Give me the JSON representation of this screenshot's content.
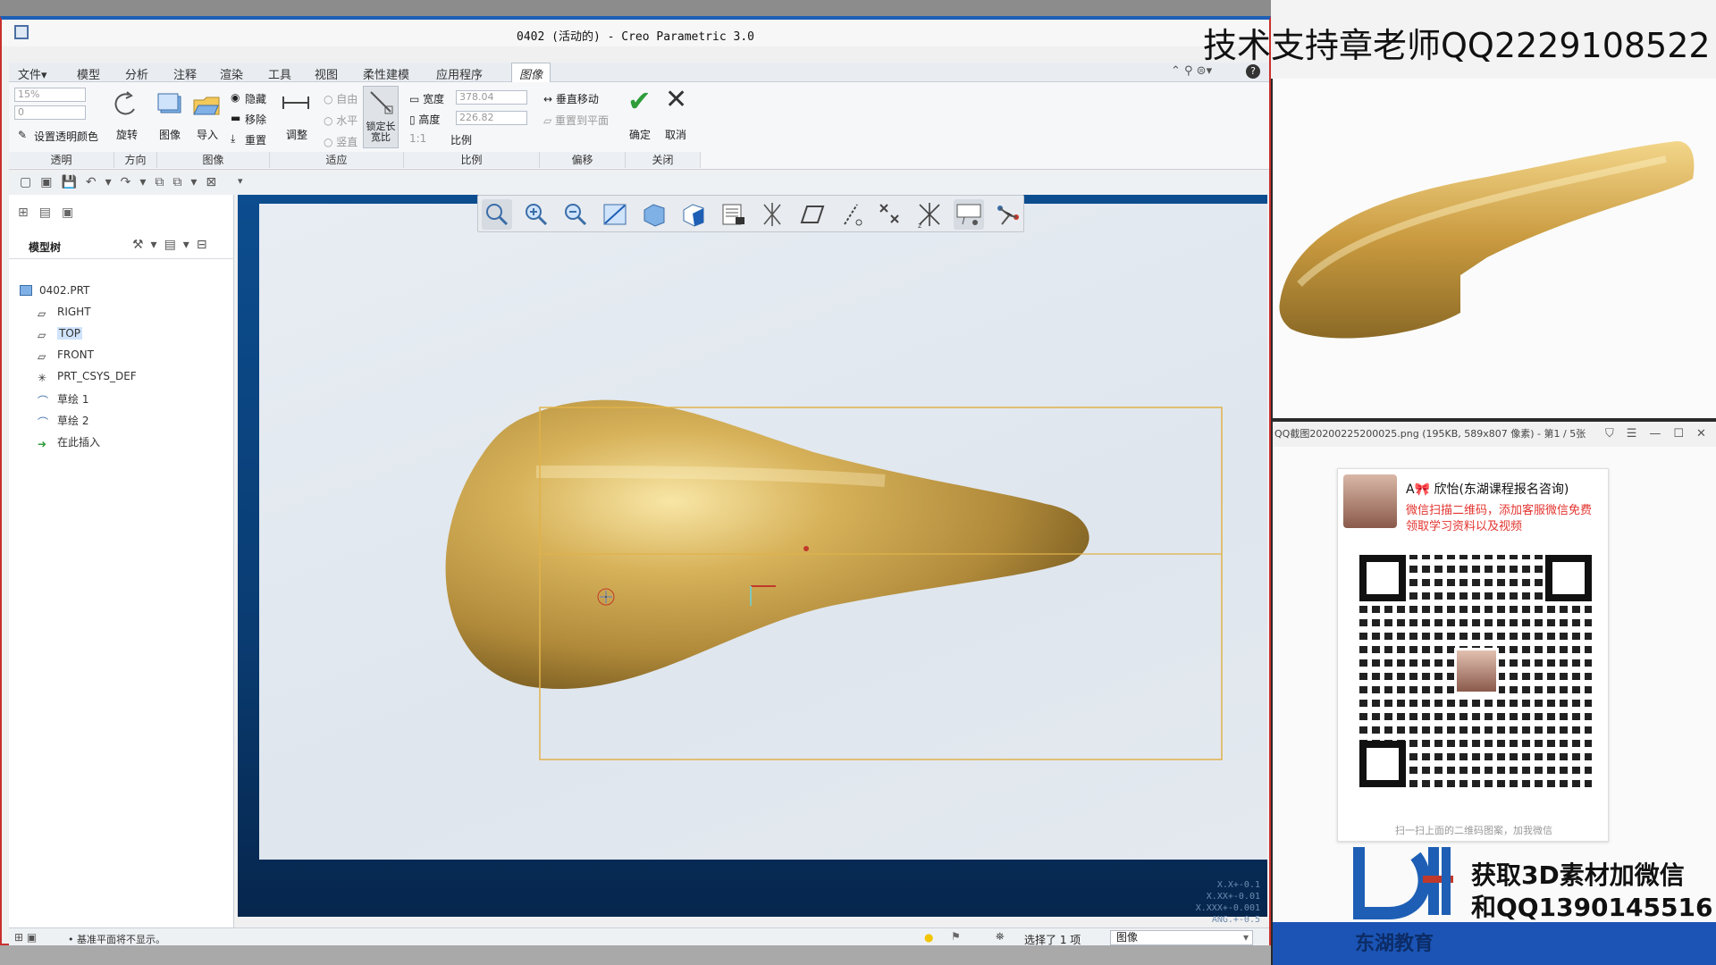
{
  "window": {
    "title": "0402 (活动的) - Creo Parametric 3.0"
  },
  "menu": {
    "items": [
      "文件▾",
      "模型",
      "分析",
      "注释",
      "渲染",
      "工具",
      "视图",
      "柔性建模",
      "应用程序",
      "图像"
    ],
    "active_index": 9
  },
  "ribbon": {
    "transparency_value": "15%",
    "transparency_value2": "0",
    "set_transparent_color": "设置透明颜色",
    "rotate": "旋转",
    "image": "图像",
    "import": "导入",
    "hide": "隐藏",
    "remove": "移除",
    "reset": "重置",
    "adjust": "调整",
    "free": "自由",
    "horizontal": "水平",
    "vertical": "竖直",
    "lock_aspect": "锁定长宽比",
    "width_label": "宽度",
    "width_value": "378.04",
    "height_label": "高度",
    "height_value": "226.82",
    "ratio_scale": "1:1",
    "ratio_label": "比例",
    "vertical_move": "垂直移动",
    "reset_to_plane": "重置到平面",
    "ok": "确定",
    "cancel": "取消",
    "groups": [
      "透明",
      "方向",
      "图像",
      "适应",
      "比例",
      "偏移",
      "关闭"
    ]
  },
  "model_tree": {
    "header": "模型树",
    "items": [
      {
        "label": "0402.PRT"
      },
      {
        "label": "RIGHT"
      },
      {
        "label": "TOP",
        "selected": true
      },
      {
        "label": "FRONT"
      },
      {
        "label": "PRT_CSYS_DEF"
      },
      {
        "label": "草绘 1"
      },
      {
        "label": "草绘 2"
      },
      {
        "label": "在此插入"
      }
    ]
  },
  "tolerance": [
    "X.X+-0.1",
    "X.XX+-0.01",
    "X.XXX+-0.001",
    "ANG.+-0.5"
  ],
  "status": {
    "message": "• 基准平面将不显示。",
    "selection": "选择了 1 项",
    "filter": "图像"
  },
  "overlay": {
    "teacher": "技术支持章老师QQ2229108522",
    "viewer_title": "QQ截图20200225200025.png (195KB, 589x807 像素) - 第1 / 5张",
    "contact_name": "A🎀 欣怡(东湖课程报名咨询)",
    "contact_note": "微信扫描二维码，添加客服微信免费领取学习资料以及视频",
    "qr_caption": "扫一扫上面的二维码图案，加我微信",
    "promo_line1": "获取3D素材加微信",
    "promo_line2": "和QQ1390145516",
    "brand": "东湖教育"
  },
  "colors": {
    "accent": "#1e5fb5",
    "model_gold": "#c9a04a",
    "bbox": "#e0b24a",
    "ok_green": "#2e9d3a"
  }
}
